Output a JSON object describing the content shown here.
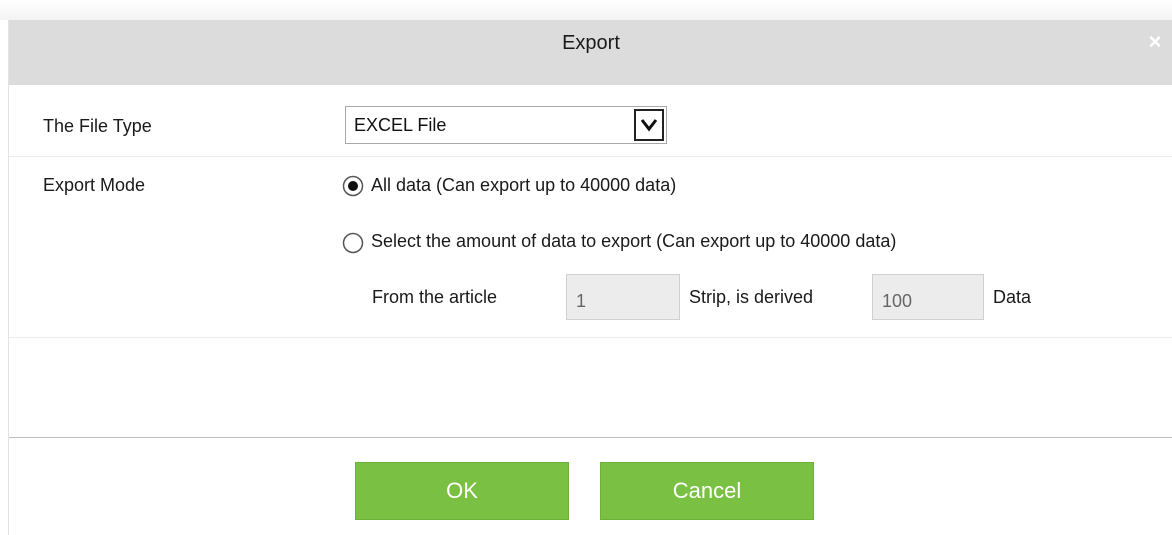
{
  "dialog": {
    "title": "Export",
    "close_symbol": "×"
  },
  "file_type": {
    "label": "The File Type",
    "selected": "EXCEL File",
    "arrow_icon": "chevron-down-icon"
  },
  "export_mode": {
    "label": "Export Mode",
    "options": [
      {
        "label": "All data (Can export up to 40000 data)",
        "selected": true
      },
      {
        "label": "Select the amount of data to export (Can export up to 40000 data)",
        "selected": false
      }
    ],
    "range": {
      "from_label": "From the article",
      "from_value": "1",
      "mid_label": "Strip, is derived",
      "count_value": "100",
      "end_label": "Data"
    }
  },
  "buttons": {
    "ok": "OK",
    "cancel": "Cancel"
  },
  "colors": {
    "titlebar": "#dcdcdc",
    "button": "#7ac143",
    "input_bg": "#ececec"
  }
}
